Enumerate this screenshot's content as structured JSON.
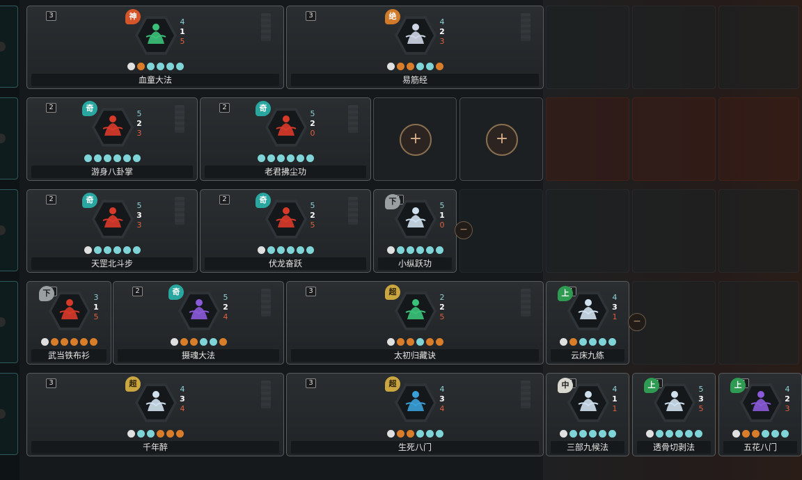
{
  "rows": [
    {
      "cards": [
        {
          "num": "3",
          "tag": "神",
          "tag_type": "shen",
          "s1": "4",
          "s2": "1",
          "s3": "5",
          "dots": [
            "w",
            "o",
            "c",
            "c",
            "c",
            "c"
          ],
          "label": "血童大法",
          "icon": "meditating-figure-icon",
          "color": "#3ac27a"
        },
        {
          "num": "3",
          "tag": "绝",
          "tag_type": "jue",
          "s1": "4",
          "s2": "2",
          "s3": "3",
          "dots": [
            "w",
            "o",
            "o",
            "c",
            "c",
            "o"
          ],
          "label": "易筋经",
          "icon": "meditating-figure-icon",
          "color": "#cfd6e6"
        }
      ]
    },
    {
      "cards": [
        {
          "num": "2",
          "tag": "奇",
          "tag_type": "qi",
          "s1": "5",
          "s2": "2",
          "s3": "3",
          "dots": [
            "c",
            "c",
            "c",
            "c",
            "c",
            "c"
          ],
          "label": "游身八卦掌",
          "icon": "fist-icon",
          "color": "#d83a2a"
        },
        {
          "num": "2",
          "tag": "奇",
          "tag_type": "qi",
          "s1": "5",
          "s2": "2",
          "s3": "0",
          "dots": [
            "c",
            "c",
            "c",
            "c",
            "c",
            "c"
          ],
          "label": "老君拂尘功",
          "icon": "whip-icon",
          "color": "#d83a2a"
        }
      ],
      "add_slots": 2
    },
    {
      "cards": [
        {
          "num": "2",
          "tag": "奇",
          "tag_type": "qi",
          "s1": "5",
          "s2": "3",
          "s3": "3",
          "dots": [
            "w",
            "c",
            "c",
            "c",
            "c",
            "c"
          ],
          "label": "天罡北斗步",
          "icon": "kick-icon",
          "color": "#d83a2a"
        },
        {
          "num": "2",
          "tag": "奇",
          "tag_type": "qi",
          "s1": "5",
          "s2": "2",
          "s3": "5",
          "dots": [
            "w",
            "c",
            "c",
            "c",
            "c",
            "c"
          ],
          "label": "伏龙奋跃",
          "icon": "leap-icon",
          "color": "#d83a2a"
        },
        {
          "num": "1",
          "tag": "下",
          "tag_type": "xia",
          "s1": "5",
          "s2": "1",
          "s3": "0",
          "dots": [
            "w",
            "c",
            "c",
            "c",
            "c",
            "c"
          ],
          "label": "小纵跃功",
          "icon": "jump-icon",
          "color": "#cfe0ee"
        }
      ]
    },
    {
      "cards": [
        {
          "num": "1",
          "tag": "下",
          "tag_type": "xia",
          "s1": "3",
          "s2": "1",
          "s3": "5",
          "dots": [
            "w",
            "o",
            "o",
            "o",
            "o",
            "o"
          ],
          "label": "武当铁布衫",
          "icon": "palm-icon",
          "color": "#d83a2a"
        },
        {
          "num": "2",
          "tag": "奇",
          "tag_type": "qi",
          "s1": "5",
          "s2": "2",
          "s3": "4",
          "dots": [
            "w",
            "o",
            "o",
            "c",
            "c",
            "o"
          ],
          "label": "摄魂大法",
          "icon": "palm-icon",
          "color": "#8a5ad8"
        },
        {
          "num": "3",
          "tag": "超",
          "tag_type": "chao",
          "s1": "2",
          "s2": "2",
          "s3": "5",
          "dots": [
            "w",
            "o",
            "o",
            "c",
            "o",
            "o"
          ],
          "label": "太初归藏诀",
          "icon": "sword-palm-icon",
          "color": "#3ac27a"
        },
        {
          "num": "1",
          "tag": "上",
          "tag_type": "shang",
          "s1": "4",
          "s2": "3",
          "s3": "1",
          "dots": [
            "w",
            "o",
            "c",
            "c",
            "c",
            "c"
          ],
          "label": "云床九练",
          "icon": "palm-icon",
          "color": "#cfe0ee"
        }
      ]
    },
    {
      "cards": [
        {
          "num": "3",
          "tag": "超",
          "tag_type": "chao",
          "s1": "4",
          "s2": "3",
          "s3": "4",
          "dots": [
            "w",
            "c",
            "c",
            "o",
            "o",
            "o"
          ],
          "label": "千年醉",
          "icon": "palm-icon",
          "color": "#cfe0ee"
        },
        {
          "num": "3",
          "tag": "超",
          "tag_type": "chao",
          "s1": "4",
          "s2": "3",
          "s3": "4",
          "dots": [
            "w",
            "o",
            "o",
            "c",
            "c",
            "c"
          ],
          "label": "生死八门",
          "icon": "palm-icon",
          "color": "#3aa0d8"
        },
        {
          "num": "1",
          "tag": "中",
          "tag_type": "zhong",
          "s1": "4",
          "s2": "1",
          "s3": "1",
          "dots": [
            "w",
            "c",
            "c",
            "c",
            "c",
            "c"
          ],
          "label": "三部九候法",
          "icon": "palm-icon",
          "color": "#cfe0ee"
        },
        {
          "num": "1",
          "tag": "上",
          "tag_type": "shang",
          "s1": "5",
          "s2": "3",
          "s3": "5",
          "dots": [
            "w",
            "c",
            "c",
            "c",
            "c",
            "c"
          ],
          "label": "透骨切剥法",
          "icon": "palm-icon",
          "color": "#cfe0ee"
        },
        {
          "num": "1",
          "tag": "上",
          "tag_type": "shang",
          "s1": "4",
          "s2": "2",
          "s3": "3",
          "dots": [
            "w",
            "o",
            "o",
            "c",
            "c",
            "c"
          ],
          "label": "五花八门",
          "icon": "palm-icon",
          "color": "#8a5ad8"
        }
      ]
    }
  ],
  "buttons": {
    "plus": "+",
    "minus": "−"
  },
  "colors": {
    "accent_teal": "#2e5a5c",
    "card_border": "#5a5d60",
    "plus_ring": "#8a7050"
  }
}
